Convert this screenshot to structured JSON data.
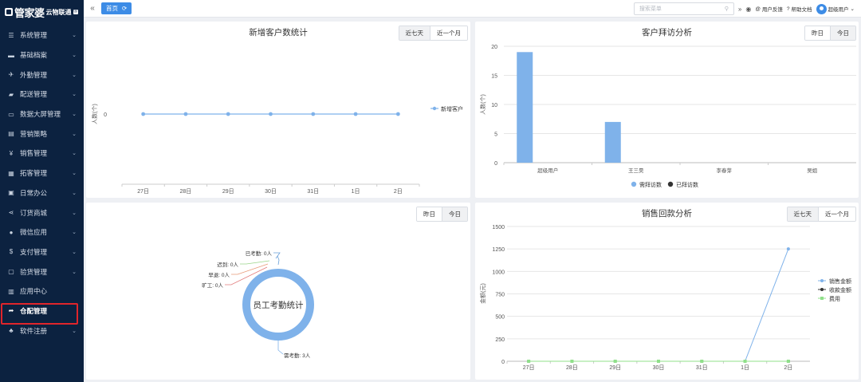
{
  "app": {
    "brand": "管家婆",
    "brand_suffix": "云物联通",
    "brand_badge": "®"
  },
  "sidebar": {
    "items": [
      {
        "label": "系统管理",
        "icon": "sliders-icon",
        "glyph": "☰",
        "chevron": true
      },
      {
        "label": "基础档案",
        "icon": "folder-icon",
        "glyph": "▬",
        "chevron": true
      },
      {
        "label": "外勤管理",
        "icon": "plane-icon",
        "glyph": "✈",
        "chevron": true
      },
      {
        "label": "配送管理",
        "icon": "truck-icon",
        "glyph": "▰",
        "chevron": true
      },
      {
        "label": "数据大屏管理",
        "icon": "monitor-icon",
        "glyph": "▭",
        "chevron": true
      },
      {
        "label": "营销策略",
        "icon": "wallet-icon",
        "glyph": "▤",
        "chevron": true
      },
      {
        "label": "销售管理",
        "icon": "yen-icon",
        "glyph": "¥",
        "chevron": true
      },
      {
        "label": "拓客管理",
        "icon": "grid-icon",
        "glyph": "▦",
        "chevron": true
      },
      {
        "label": "日常办公",
        "icon": "briefcase-icon",
        "glyph": "▣",
        "chevron": true
      },
      {
        "label": "订货商城",
        "icon": "share-icon",
        "glyph": "⋖",
        "chevron": true
      },
      {
        "label": "微信应用",
        "icon": "wechat-icon",
        "glyph": "●",
        "chevron": true
      },
      {
        "label": "支付管理",
        "icon": "dollar-icon",
        "glyph": "$",
        "chevron": true
      },
      {
        "label": "验货管理",
        "icon": "inbox-icon",
        "glyph": "▢",
        "chevron": true
      },
      {
        "label": "应用中心",
        "icon": "calendar-icon",
        "glyph": "▥",
        "chevron": false
      },
      {
        "label": "仓配管理",
        "icon": "forward-icon",
        "glyph": "➦",
        "chevron": false,
        "active": true
      },
      {
        "label": "软件注册",
        "icon": "sitemap-icon",
        "glyph": "♣",
        "chevron": true
      }
    ]
  },
  "topbar": {
    "home_tab": "首页",
    "search_placeholder": "搜索菜单",
    "feedback": "用户反馈",
    "help": "帮助文档",
    "user": "超级用户"
  },
  "panels": {
    "new_customers": {
      "title": "新增客户数统计",
      "btn_a": "近七天",
      "btn_b": "近一个月"
    },
    "visits": {
      "title": "客户拜访分析",
      "btn_a": "昨日",
      "btn_b": "今日"
    },
    "attendance": {
      "btn_a": "昨日",
      "btn_b": "今日"
    },
    "payments": {
      "title": "销售回款分析",
      "btn_a": "近七天",
      "btn_b": "近一个月"
    }
  },
  "colors": {
    "accent": "#3d8ce6",
    "sidebar_bg": "#0c2240",
    "series_blue": "#7fb2ea",
    "series_dark": "#333333",
    "series_green": "#90e08a",
    "highlight": "#e0252b"
  },
  "chart_data": [
    {
      "type": "line",
      "title": "新增客户数统计",
      "ylabel": "人数(个)",
      "x": [
        "27日",
        "28日",
        "29日",
        "30日",
        "31日",
        "1日",
        "2日"
      ],
      "y_ticks": [
        0
      ],
      "series": [
        {
          "name": "新增客户",
          "values": [
            0,
            0,
            0,
            0,
            0,
            0,
            0
          ]
        }
      ],
      "legend": "right"
    },
    {
      "type": "bar",
      "title": "客户拜访分析",
      "ylabel": "人数(个)",
      "categories": [
        "超级用户",
        "王三昊",
        "李春芽",
        "吴姐"
      ],
      "ylim": [
        0,
        20
      ],
      "y_ticks": [
        0,
        5,
        10,
        15,
        20
      ],
      "series": [
        {
          "name": "需拜访数",
          "values": [
            19,
            7,
            0,
            0
          ]
        },
        {
          "name": "已拜访数",
          "values": [
            0,
            0,
            0,
            0
          ]
        }
      ],
      "legend": "bottom"
    },
    {
      "type": "pie",
      "title": "员工考勤统计",
      "slices": [
        {
          "label": "已考勤: 0人",
          "value": 0
        },
        {
          "label": "迟到: 0人",
          "value": 0
        },
        {
          "label": "早退: 0人",
          "value": 0
        },
        {
          "label": "旷工: 0人",
          "value": 0
        },
        {
          "label": "需考勤: 3人",
          "value": 3
        }
      ]
    },
    {
      "type": "line",
      "title": "销售回款分析",
      "ylabel": "金额(元)",
      "x": [
        "27日",
        "28日",
        "29日",
        "30日",
        "31日",
        "1日",
        "2日"
      ],
      "ylim": [
        0,
        1500
      ],
      "y_ticks": [
        0,
        250,
        500,
        750,
        1000,
        1250,
        1500
      ],
      "series": [
        {
          "name": "销售金额",
          "values": [
            0,
            0,
            0,
            0,
            0,
            0,
            1250
          ]
        },
        {
          "name": "收款金额",
          "values": [
            0,
            0,
            0,
            0,
            0,
            0,
            0
          ]
        },
        {
          "name": "费用",
          "values": [
            0,
            0,
            0,
            0,
            0,
            0,
            0
          ]
        }
      ],
      "legend": "right"
    }
  ]
}
